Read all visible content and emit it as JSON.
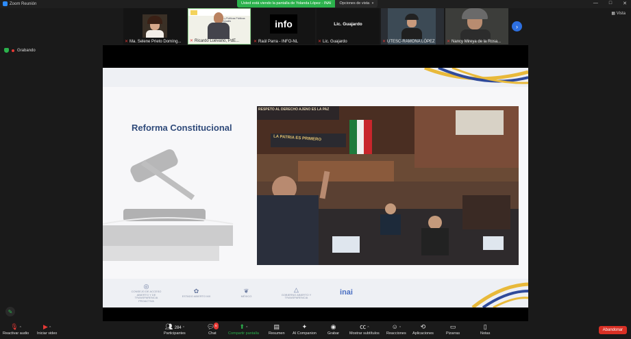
{
  "window": {
    "title": "Zoom Reunión",
    "controls": [
      "—",
      "□",
      "✕"
    ]
  },
  "share_banner": {
    "text": "Usted está viendo la pantalla de Yolanda López - INAI",
    "options_label": "Opciones de vista"
  },
  "view_button": {
    "label": "Vista"
  },
  "recording": {
    "label": "Grabando"
  },
  "participants": [
    {
      "name": "Ma. Selene Prieto Domíng..."
    },
    {
      "name": "Ricardo Luévano, PdE...",
      "slide_text": "Modelo y Políticas Públicas Institucionales"
    },
    {
      "name": "Raúl Parra - INFO-NL",
      "logo_text": "info"
    },
    {
      "name": "Lic. Guajardo",
      "center_label": "Lic. Guajardo"
    },
    {
      "name": "UTESC-RAMONA LÓPEZ"
    },
    {
      "name": "Nancy Mireya de la Rosa..."
    }
  ],
  "slide": {
    "title": "Reforma Constitucional",
    "photo_banner_text": "LA PATRIA ES PRIMERO",
    "photo_top_text": "RESPETO AL DERECHO AJENO ES LA PAZ",
    "logos": [
      {
        "mark": "◎",
        "text": "CONSEJO DE ACCESO ABIERTO Y DE TRANSPARENCIA PROACTIVA"
      },
      {
        "mark": "✿",
        "text": "ESTADO ABIERTO MX"
      },
      {
        "mark": "❦",
        "text": "MÉXICO"
      },
      {
        "mark": "△",
        "text": "GOBIERNO ABIERTO Y TRANSPARENCIA"
      },
      {
        "mark": "inai",
        "text": ""
      }
    ]
  },
  "toolbar": {
    "reactivate_audio": "Reactivar audio",
    "start_video": "Iniciar video",
    "participants_label": "Participantes",
    "participants_count": "284",
    "chat_label": "Chat",
    "chat_badge": "5",
    "share_label": "Compartir pantalla",
    "summary_label": "Resumen",
    "ai_label": "AI Companion",
    "record_label": "Grabar",
    "captions_label": "Mostrar subtítulos",
    "reactions_label": "Reacciones",
    "apps_label": "Aplicaciones",
    "whiteboards_label": "Pizarras",
    "notes_label": "Notas",
    "leave_label": "Abandonar"
  },
  "colors": {
    "accent": "#2d8cff",
    "share_green": "#2bb24c",
    "leave_red": "#d93025",
    "slide_title": "#2f4a7a"
  }
}
